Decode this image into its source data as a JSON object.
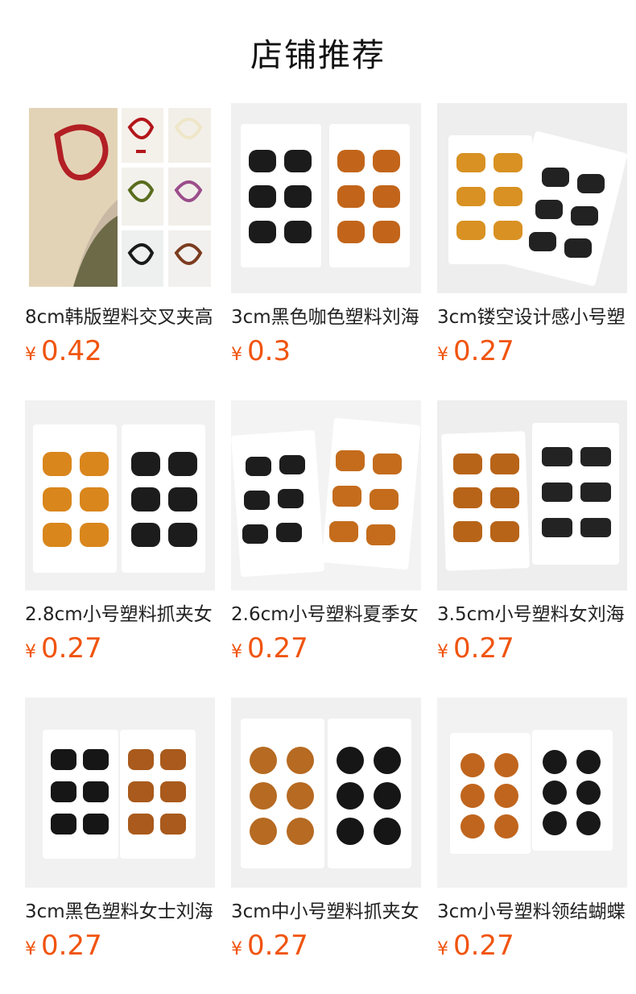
{
  "header": {
    "title": "店铺推荐"
  },
  "currency": "¥",
  "colors": {
    "price": "#f0540e",
    "card_bg": "#ffffff",
    "photo_bg": "#f3f3f3"
  },
  "products": [
    {
      "name": "8cm韩版塑料交叉夹高",
      "price": "0.42",
      "image": "hair-claw-model-photo"
    },
    {
      "name": "3cm黑色咖色塑料刘海",
      "price": "0.3",
      "image": "hair-clip-cards-black-amber"
    },
    {
      "name": "3cm镂空设计感小号塑",
      "price": "0.27",
      "image": "hair-clip-cards-hollow"
    },
    {
      "name": "2.8cm小号塑料抓夹女",
      "price": "0.27",
      "image": "hair-clip-cards-amber-black"
    },
    {
      "name": "2.6cm小号塑料夏季女",
      "price": "0.27",
      "image": "hair-clip-cards-fashion"
    },
    {
      "name": "3.5cm小号塑料女刘海",
      "price": "0.27",
      "image": "hair-clip-cards-tortoise"
    },
    {
      "name": "3cm黑色塑料女士刘海",
      "price": "0.27",
      "image": "hair-clip-cards-black-tortoise"
    },
    {
      "name": "3cm中小号塑料抓夹女",
      "price": "0.27",
      "image": "hair-clip-cards-tortoise-black"
    },
    {
      "name": "3cm小号塑料领结蝴蝶",
      "price": "0.27",
      "image": "hair-clip-cards-bow"
    }
  ]
}
